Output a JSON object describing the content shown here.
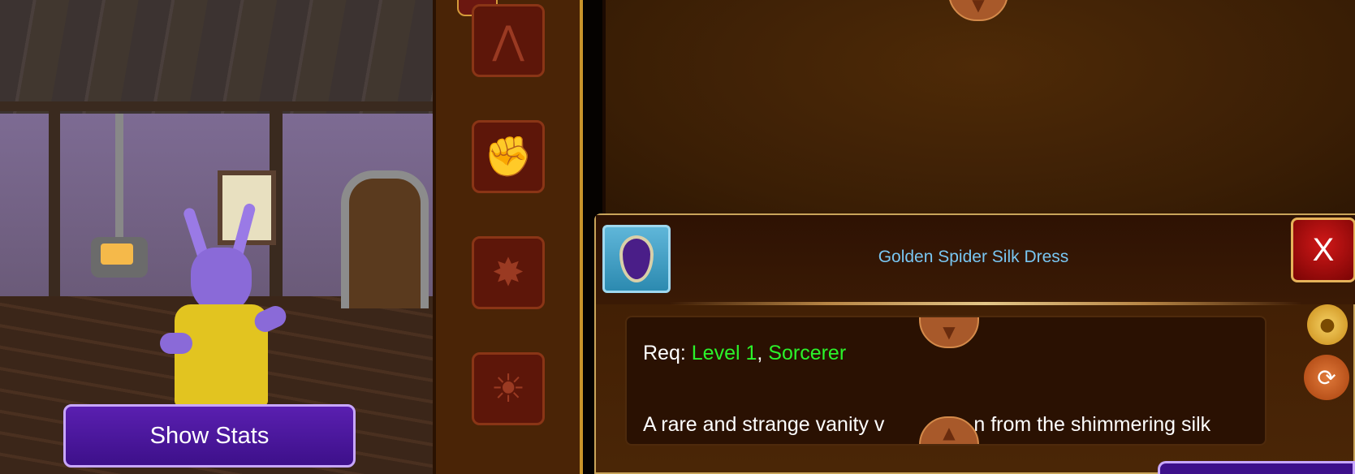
{
  "scene": {
    "show_stats_label": "Show Stats"
  },
  "categories": [
    {
      "name": "banner",
      "glyph": "⋀"
    },
    {
      "name": "fist",
      "glyph": "✊"
    },
    {
      "name": "burst",
      "glyph": "✸"
    },
    {
      "name": "sun",
      "glyph": "☀"
    }
  ],
  "item": {
    "title": "Golden Spider Silk Dress",
    "req_label": "Req:",
    "req_level": "Level 1",
    "req_sep": ",",
    "req_class": "Sorcerer",
    "description_visible": "A rare and strange vanity v",
    "description_visible_2": "n from the shimmering silk",
    "close_label": "X"
  },
  "icons": {
    "coin_bag": "coin-bag-icon",
    "swap": "swap-icon",
    "scroll_down": "▼",
    "scroll_up": "▲"
  },
  "colors": {
    "title": "#79c6f2",
    "requirement": "#2bf32b",
    "stats_button": "#4a16a0",
    "close_button": "#b40c0c"
  }
}
